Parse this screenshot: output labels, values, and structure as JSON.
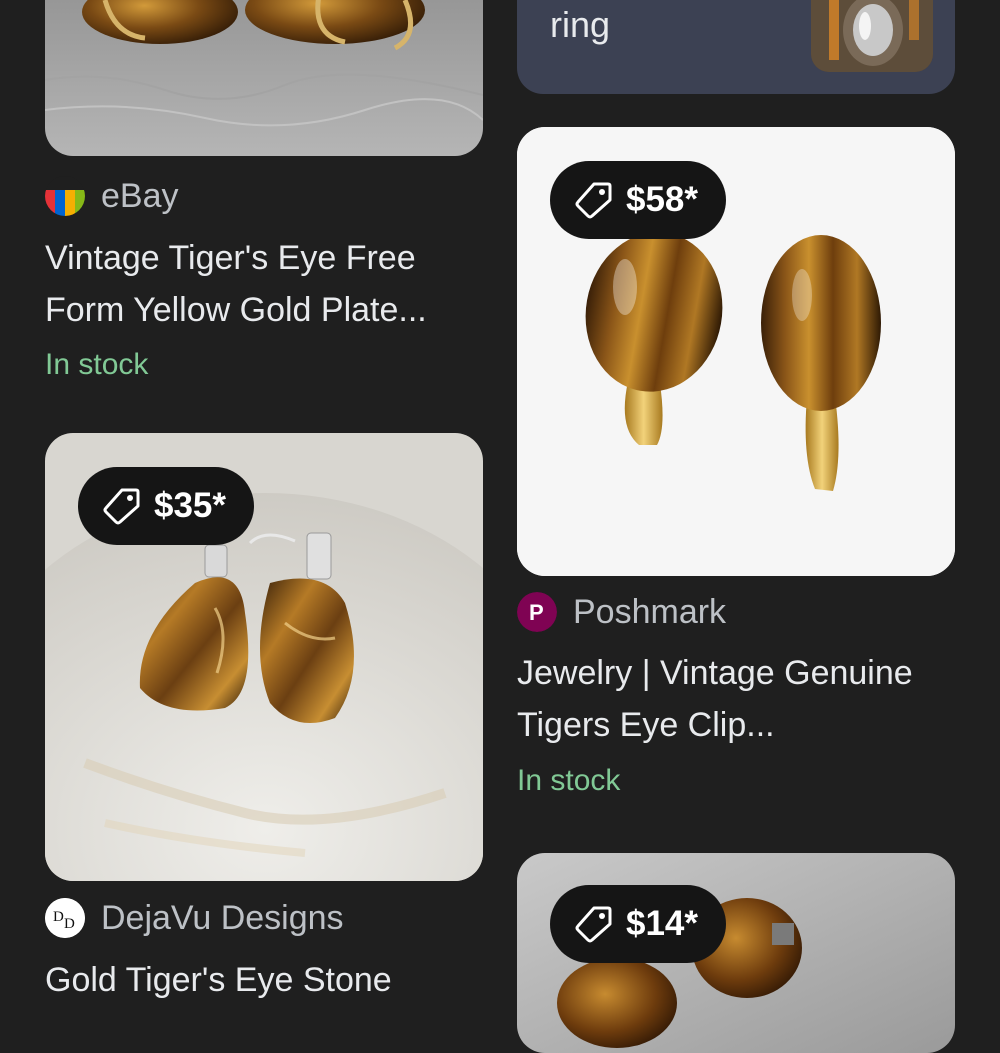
{
  "results": [
    {
      "source": "eBay",
      "title": "Vintage Tiger's Eye Free Form Yellow Gold Plate...",
      "stock": "In stock"
    },
    {
      "related_text": "ring"
    },
    {
      "price": "$58*",
      "source": "Poshmark",
      "title": "Jewelry | Vintage Genuine Tigers Eye Clip...",
      "stock": "In stock"
    },
    {
      "price": "$35*",
      "source": "DejaVu Designs",
      "title": "Gold Tiger's Eye Stone"
    },
    {
      "price": "$14*"
    }
  ],
  "colors": {
    "background": "#1f1f1f",
    "in_stock": "#81c995",
    "chip": "#151515",
    "related_card": "#3c4153"
  },
  "icons": {
    "price_tag": "price-tag-icon"
  }
}
